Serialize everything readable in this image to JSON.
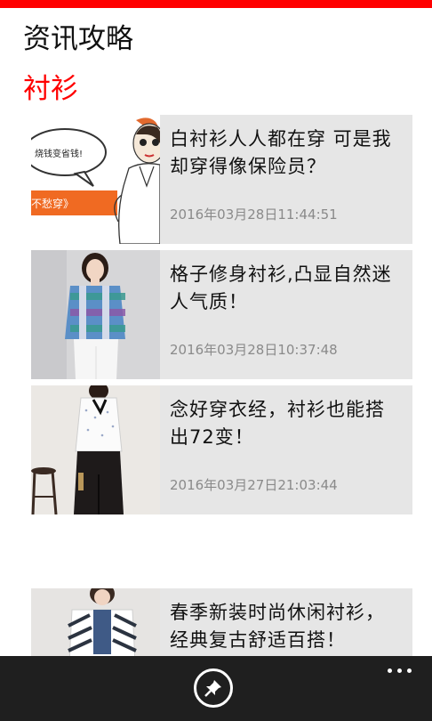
{
  "header": {
    "app_title": "资讯攻略",
    "pivot_title": "衬衫"
  },
  "articles": [
    {
      "title": "白衬衫人人都在穿 可是我却穿得像保险员？",
      "date": "2016年03月28日11:44:51",
      "thumb_text_top": "烧钱变省钱!",
      "thumb_text_bottom": "不愁穿》"
    },
    {
      "title": "格子修身衬衫,凸显自然迷人气质！",
      "date": "2016年03月28日10:37:48"
    },
    {
      "title": "念好穿衣经，衬衫也能搭出72变！",
      "date": "2016年03月27日21:03:44"
    },
    {
      "title": "春季新装时尚休闲衬衫，经典复古舒适百搭！",
      "date": ""
    }
  ],
  "app_bar": {
    "pin_icon": "pin-icon",
    "more_icon": "more-icon"
  },
  "colors": {
    "accent": "#ff0000",
    "card_bg": "#e6e6e6",
    "app_bar_bg": "#1f1f1f",
    "date_text": "#8a8a8a"
  }
}
